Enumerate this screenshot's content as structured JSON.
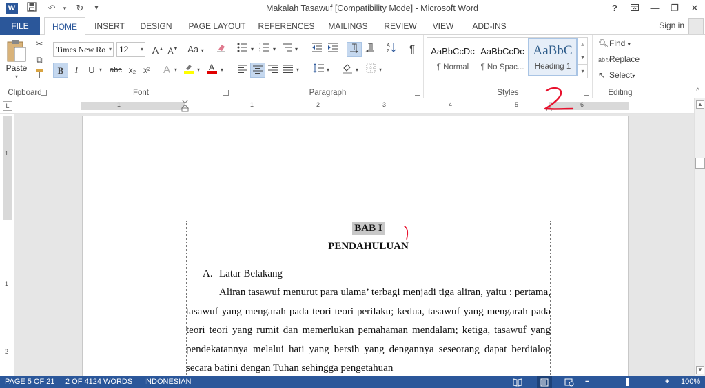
{
  "window": {
    "title": "Makalah Tasawuf [Compatibility Mode] - Microsoft Word",
    "app_logo": "W",
    "help": "?",
    "controls": [
      "ribbon-display-icon",
      "minimize-icon",
      "restore-icon",
      "close-icon"
    ]
  },
  "tabs": {
    "file": "FILE",
    "items": [
      "HOME",
      "INSERT",
      "DESIGN",
      "PAGE LAYOUT",
      "REFERENCES",
      "MAILINGS",
      "REVIEW",
      "VIEW",
      "ADD-INS"
    ],
    "active": "HOME",
    "signin": "Sign in"
  },
  "ribbon": {
    "clipboard": {
      "label": "Clipboard",
      "paste": "Paste"
    },
    "font": {
      "label": "Font",
      "font_name": "Times New Ro",
      "font_size": "12",
      "bold": "B",
      "italic": "I",
      "underline": "U",
      "strike": "abc",
      "subscript": "x₂",
      "superscript": "x²",
      "grow": "A",
      "shrink": "A",
      "case": "Aa"
    },
    "paragraph": {
      "label": "Paragraph",
      "pilcrow": "¶"
    },
    "styles": {
      "label": "Styles",
      "items": [
        {
          "sample": "AaBbCcDc",
          "name": "¶ Normal"
        },
        {
          "sample": "AaBbCcDc",
          "name": "¶ No Spac..."
        },
        {
          "sample": "AaBbC",
          "name": "Heading 1"
        }
      ]
    },
    "editing": {
      "label": "Editing",
      "find": "Find",
      "replace": "Replace",
      "select": "Select"
    }
  },
  "ruler": {
    "labels": [
      "1",
      "1",
      "2",
      "3",
      "4",
      "5",
      "6"
    ]
  },
  "vruler": {
    "labels": [
      "1",
      "1",
      "2"
    ]
  },
  "document": {
    "heading1": "BAB I",
    "heading2": "PENDAHULUAN",
    "subheading_num": "A.",
    "subheading": "Latar Belakang",
    "paragraph": "Aliran tasawuf menurut para ulama’ terbagi menjadi tiga aliran, yaitu : pertama, tasawuf yang mengarah pada teori teori perilaku; kedua, tasawuf yang mengarah pada teori teori yang rumit dan memerlukan pemahaman mendalam; ketiga, tasawuf yang pendekatannya melalui hati yang bersih yang dengannya seseorang dapat berdialog secara batini dengan Tuhan sehingga pengetahuan"
  },
  "status": {
    "page": "PAGE 5 OF 21",
    "words": "2 OF 4124 WORDS",
    "language": "INDONESIAN",
    "zoom": "100%"
  },
  "colors": {
    "accent": "#2b579a",
    "annotation": "#e8112d"
  }
}
